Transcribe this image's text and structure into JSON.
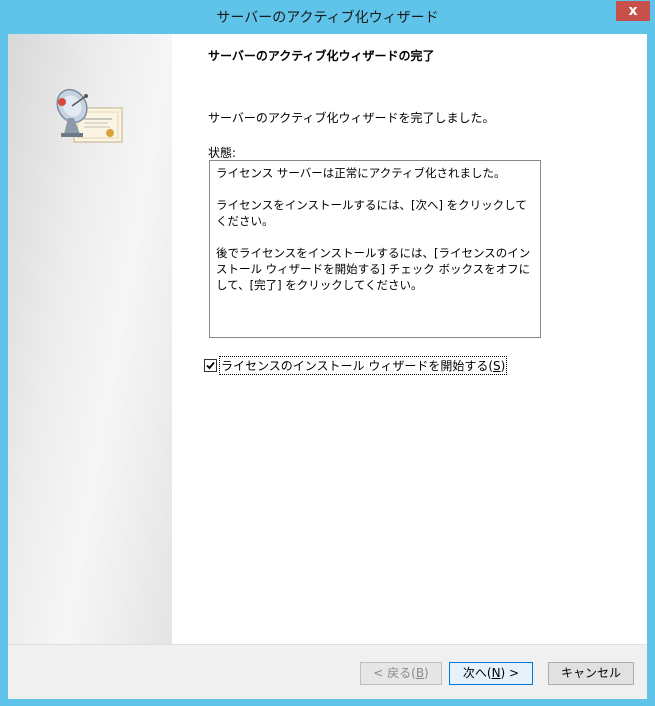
{
  "window": {
    "title": "サーバーのアクティブ化ウィザード",
    "close_label": "x"
  },
  "sidebar": {
    "icon": "server-certificate-icon"
  },
  "main": {
    "heading": "サーバーのアクティブ化ウィザードの完了",
    "message": "サーバーのアクティブ化ウィザードを完了しました。",
    "status_label": "状態:",
    "status_lines": [
      "ライセンス サーバーは正常にアクティブ化されました。",
      "ライセンスをインストールするには、[次へ] をクリックしてください。",
      "後でライセンスをインストールするには、[ライセンスのインストール ウィザードを開始する] チェック ボックスをオフにして、[完了] をクリックしてください。"
    ],
    "checkbox": {
      "label_text": "ライセンスのインストール ウィザードを開始する(",
      "label_key": "S",
      "label_end": ")",
      "checked": true
    }
  },
  "footer": {
    "back": {
      "pre": "< 戻る(",
      "key": "B",
      "post": ")"
    },
    "next": {
      "pre": "次へ(",
      "key": "N",
      "post": ") >"
    },
    "cancel_label": "キャンセル"
  },
  "colors": {
    "titlebar": "#5fc3ea",
    "close_button": "#c7504a",
    "default_button_border": "#0078d7"
  }
}
